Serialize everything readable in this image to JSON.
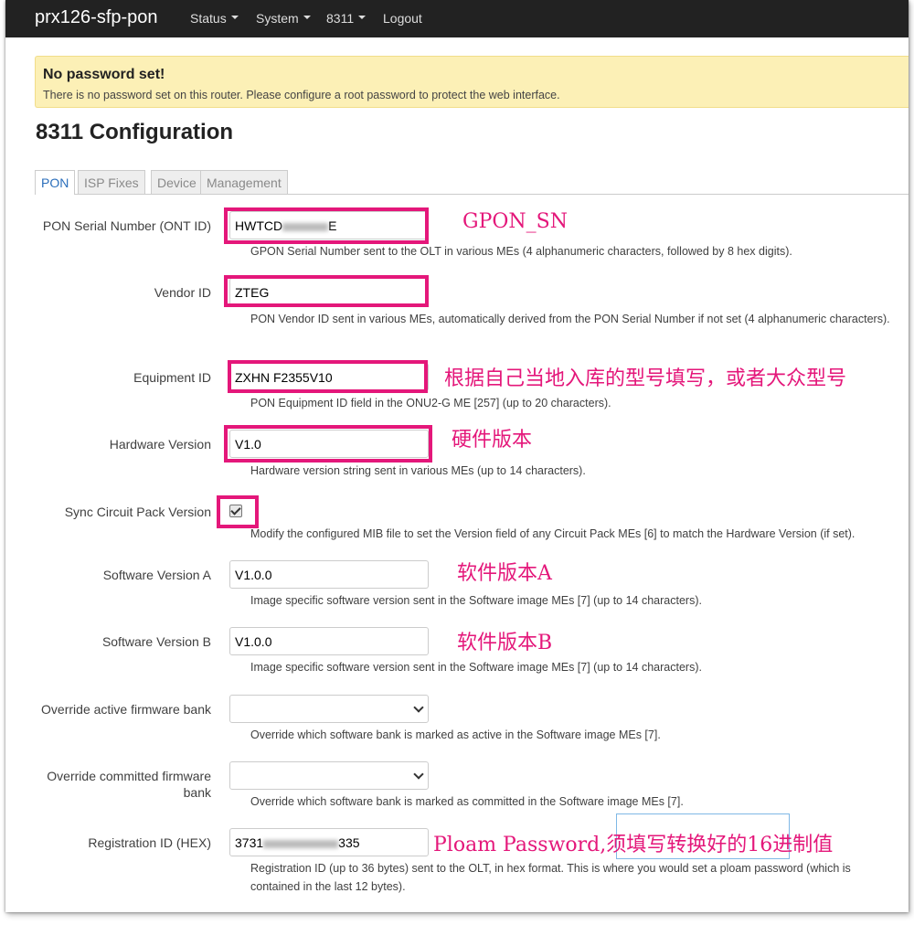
{
  "navbar": {
    "brand": "prx126-sfp-pon",
    "items": [
      {
        "label": "Status"
      },
      {
        "label": "System"
      },
      {
        "label": "8311"
      },
      {
        "label": "Logout"
      }
    ]
  },
  "alert": {
    "title": "No password set!",
    "text": "There is no password set on this router. Please configure a root password to protect the web interface."
  },
  "page_title": "8311 Configuration",
  "tabs": [
    "PON",
    "ISP Fixes",
    "Device",
    "Management"
  ],
  "fields": {
    "serial": {
      "label": "PON Serial Number (ONT ID)",
      "value_prefix": "HWTCD",
      "value_suffix": "E",
      "hint": "GPON Serial Number sent to the OLT in various MEs (4 alphanumeric characters, followed by 8 hex digits).",
      "annotation": "GPON_SN"
    },
    "vendor": {
      "label": "Vendor ID",
      "value": "ZTEG",
      "hint": "PON Vendor ID sent in various MEs, automatically derived from the PON Serial Number if not set (4 alphanumeric characters)."
    },
    "equipment": {
      "label": "Equipment ID",
      "value": "ZXHN F2355V10",
      "hint": "PON Equipment ID field in the ONU2-G ME [257] (up to 20 characters).",
      "annotation": "根据自己当地入库的型号填写，或者大众型号"
    },
    "hardware": {
      "label": "Hardware Version",
      "value": "V1.0",
      "hint": "Hardware version string sent in various MEs (up to 14 characters).",
      "annotation": "硬件版本"
    },
    "sync": {
      "label": "Sync Circuit Pack Version",
      "checked": true,
      "hint": "Modify the configured MIB file to set the Version field of any Circuit Pack MEs [6] to match the Hardware Version (if set)."
    },
    "sw_a": {
      "label": "Software Version A",
      "value": "V1.0.0",
      "hint": "Image specific software version sent in the Software image MEs [7] (up to 14 characters).",
      "annotation": "软件版本A"
    },
    "sw_b": {
      "label": "Software Version B",
      "value": "V1.0.0",
      "hint": "Image specific software version sent in the Software image MEs [7] (up to 14 characters).",
      "annotation": "软件版本B"
    },
    "active_bank": {
      "label": "Override active firmware bank",
      "value": "",
      "hint": "Override which software bank is marked as active in the Software image MEs [7]."
    },
    "committed_bank": {
      "label_line1": "Override committed firmware",
      "label_line2": "bank",
      "value": "",
      "hint": "Override which software bank is marked as committed in the Software image MEs [7]."
    },
    "registration": {
      "label": "Registration ID (HEX)",
      "value_prefix": "3731",
      "value_suffix": "335",
      "hint_line1": "Registration ID (up to 36 bytes) sent to the OLT, in hex format. This is where you would set a ploam password (which is",
      "hint_line2": "contained in the last 12 bytes).",
      "annotation": "Ploam Password,须填写转换好的16进制值"
    }
  },
  "colors": {
    "navbar_bg": "#222222",
    "alert_bg": "#fcf0b6",
    "annotation": "#e4177a",
    "tab_active": "#2a6ebb"
  }
}
